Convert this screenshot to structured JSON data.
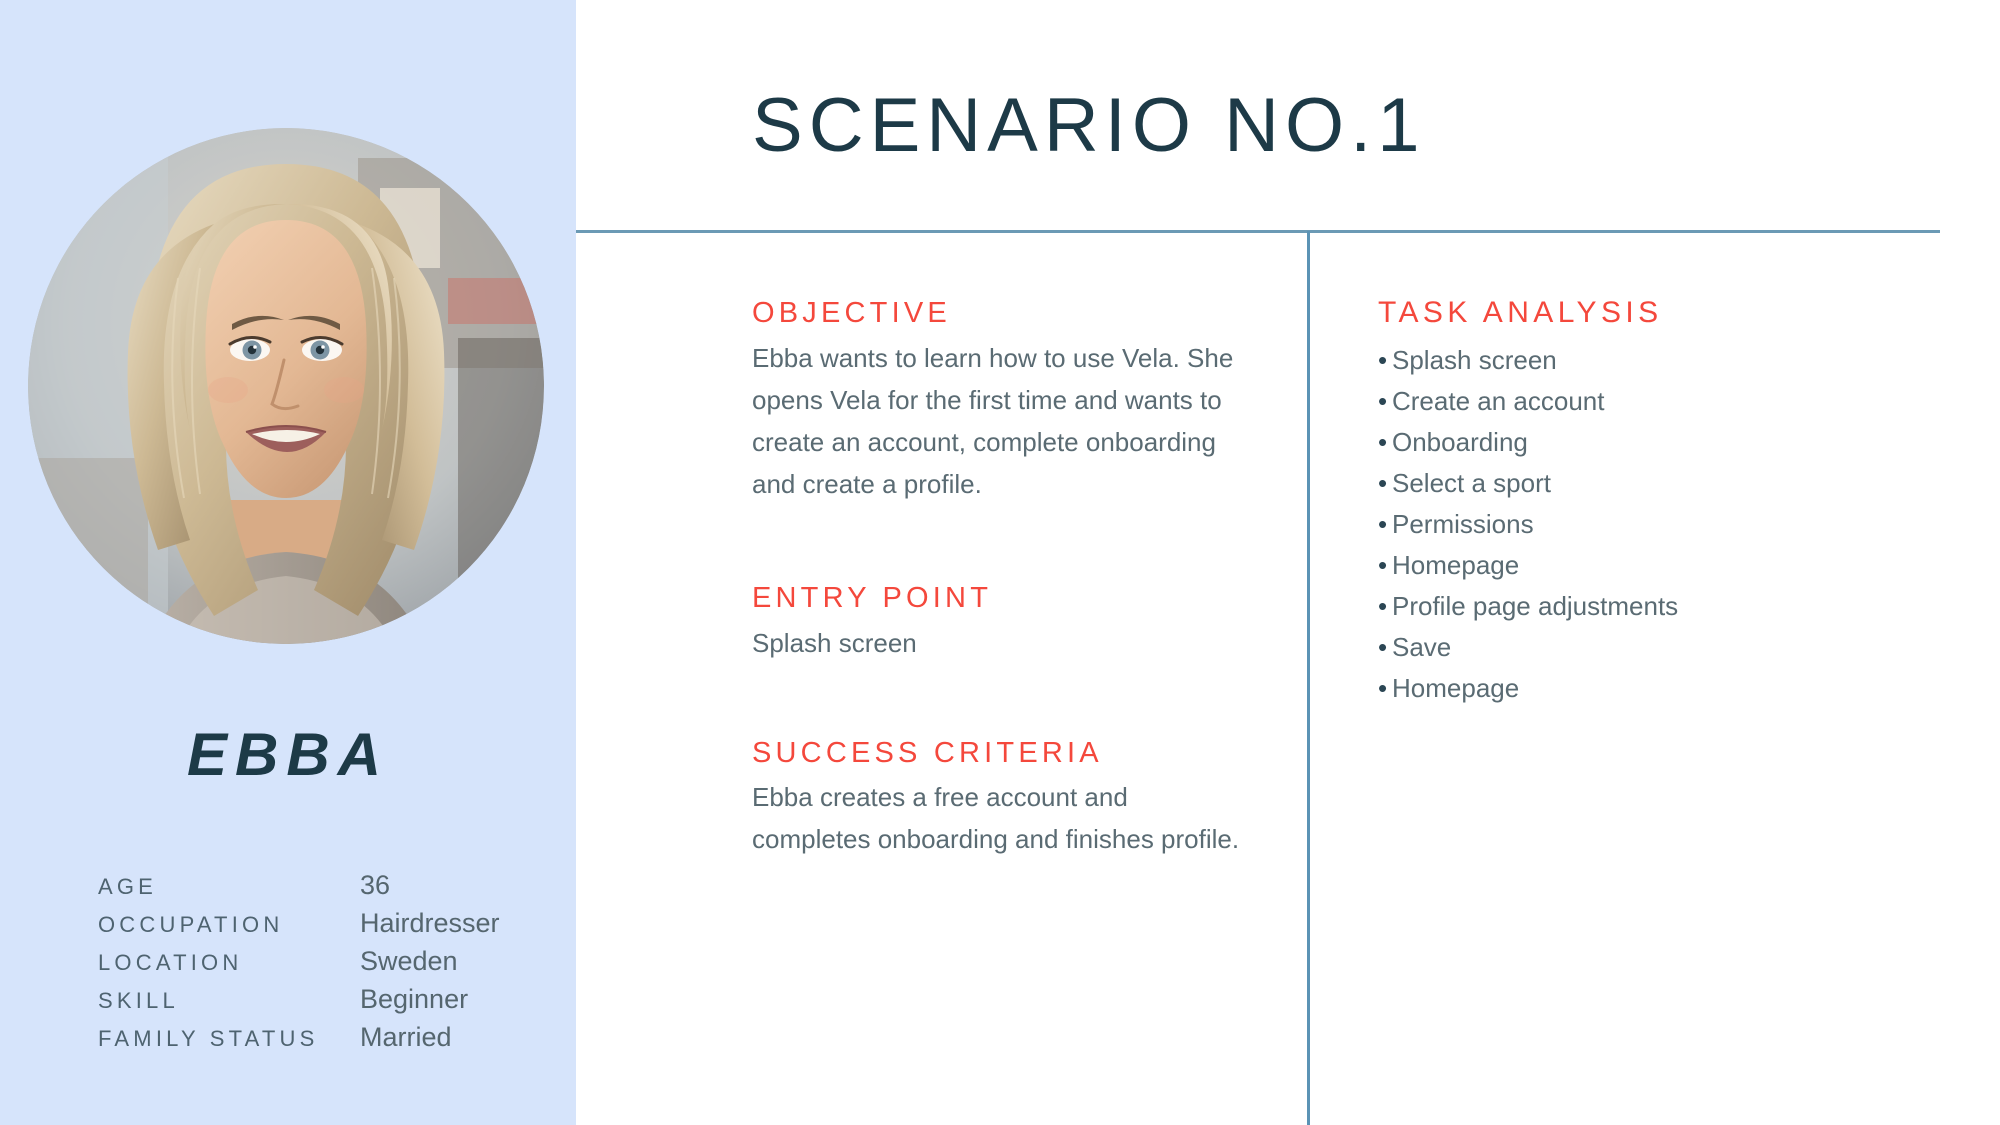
{
  "theme": {
    "sidebar_bg": "#d6e4fb",
    "accent_red": "#f4483c",
    "heading_navy": "#1d3a47",
    "body_gray": "#5a6b73",
    "rule_blue": "#6b9ab5"
  },
  "persona": {
    "name": "EBBA",
    "avatar_alt": "smiling blonde woman portrait",
    "attributes": [
      {
        "label": "AGE",
        "value": "36"
      },
      {
        "label": "OCCUPATION",
        "value": "Hairdresser"
      },
      {
        "label": "LOCATION",
        "value": "Sweden"
      },
      {
        "label": "SKILL",
        "value": "Beginner"
      },
      {
        "label": "FAMILY STATUS",
        "value": "Married"
      }
    ]
  },
  "main": {
    "title": "SCENARIO NO.1",
    "left_column": [
      {
        "heading": "OBJECTIVE",
        "body": "Ebba wants to learn how to use Vela. She opens Vela for the first time and wants to create an account, complete onboarding and create a profile."
      },
      {
        "heading": "ENTRY POINT",
        "body": "Splash screen"
      },
      {
        "heading": "SUCCESS CRITERIA",
        "body": "Ebba creates a free account and completes onboarding and finishes profile."
      }
    ],
    "right_column": {
      "heading": "TASK ANALYSIS",
      "items": [
        "Splash screen",
        "Create an account",
        "Onboarding",
        "Select a sport",
        "Permissions",
        "Homepage",
        "Profile page adjustments",
        "Save",
        "Homepage"
      ]
    }
  }
}
